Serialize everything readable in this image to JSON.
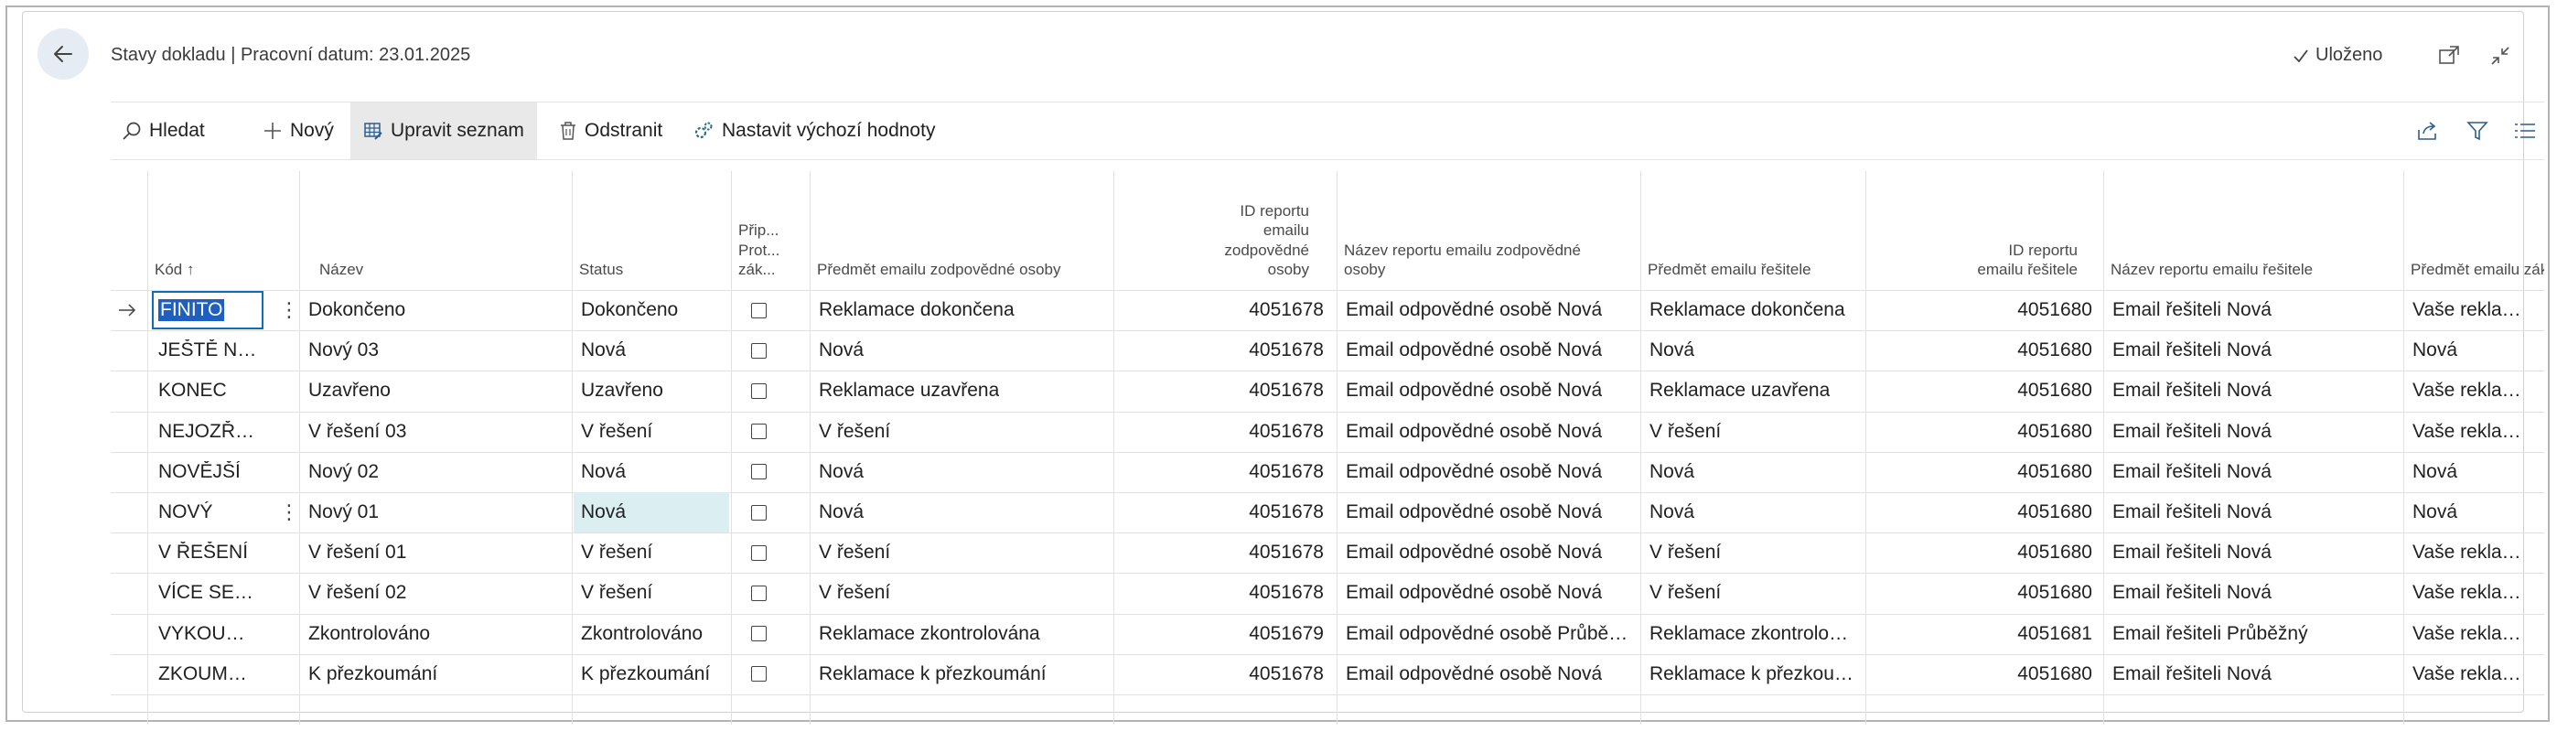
{
  "header": {
    "title": "Stavy dokladu | Pracovní datum: 23.01.2025",
    "saved_label": "Uloženo"
  },
  "actions": {
    "search": "Hledat",
    "new": "Nový",
    "edit_list": "Upravit seznam",
    "delete": "Odstranit",
    "set_defaults": "Nastavit výchozí hodnoty"
  },
  "columns": {
    "code": "Kód ↑",
    "name": "Název",
    "status": "Status",
    "attach_l1": "Přip...",
    "attach_l2": "Prot...",
    "attach_l3": "zák...",
    "resp_subject": "Předmět emailu zodpovědné osoby",
    "resp_report_id_l1": "ID reportu",
    "resp_report_id_l2": "emailu",
    "resp_report_id_l3": "zodpovědné",
    "resp_report_id_l4": "osoby",
    "resp_report_name_l1": "Název reportu emailu zodpovědné",
    "resp_report_name_l2": "osoby",
    "solver_subject": "Předmět emailu řešitele",
    "solver_report_id_l1": "ID reportu",
    "solver_report_id_l2": "emailu řešitele",
    "solver_report_name": "Název reportu emailu řešitele",
    "customer_subject": "Předmět emailu zákazníka"
  },
  "rows": [
    {
      "code": "FINITO",
      "name": "Dokončeno",
      "status": "Dokončeno",
      "resp_subject": "Reklamace dokončena",
      "resp_id": "4051678",
      "resp_report": "Email odpovědné osobě Nová",
      "solver_subject": "Reklamace dokončena",
      "solver_id": "4051680",
      "solver_report": "Email řešiteli Nová",
      "customer_subject": "Vaše reklamace byla dokončena"
    },
    {
      "code": "JEŠTĚ NOVĚJŠÍ",
      "name": "Nový 03",
      "status": "Nová",
      "resp_subject": "Nová",
      "resp_id": "4051678",
      "resp_report": "Email odpovědné osobě Nová",
      "solver_subject": "Nová",
      "solver_id": "4051680",
      "solver_report": "Email řešiteli Nová",
      "customer_subject": "Nová"
    },
    {
      "code": "KONEC",
      "name": "Uzavřeno",
      "status": "Uzavřeno",
      "resp_subject": "Reklamace uzavřena",
      "resp_id": "4051678",
      "resp_report": "Email odpovědné osobě Nová",
      "solver_subject": "Reklamace uzavřena",
      "solver_id": "4051680",
      "solver_report": "Email řešiteli Nová",
      "customer_subject": "Vaše reklamace byla uzavřena"
    },
    {
      "code": "NEJOZŘEŠENĚJŠÍ",
      "name": "V řešení 03",
      "status": "V řešení",
      "resp_subject": "V řešení",
      "resp_id": "4051678",
      "resp_report": "Email odpovědné osobě Nová",
      "solver_subject": "V řešení",
      "solver_id": "4051680",
      "solver_report": "Email řešiteli Nová",
      "customer_subject": "Vaše reklamace je nyní v řešení"
    },
    {
      "code": "NOVĚJŠÍ",
      "name": "Nový 02",
      "status": "Nová",
      "resp_subject": "Nová",
      "resp_id": "4051678",
      "resp_report": "Email odpovědné osobě Nová",
      "solver_subject": "Nová",
      "solver_id": "4051680",
      "solver_report": "Email řešiteli Nová",
      "customer_subject": "Nová"
    },
    {
      "code": "NOVÝ",
      "name": "Nový 01",
      "status": "Nová",
      "resp_subject": "Nová",
      "resp_id": "4051678",
      "resp_report": "Email odpovědné osobě Nová",
      "solver_subject": "Nová",
      "solver_id": "4051680",
      "solver_report": "Email řešiteli Nová",
      "customer_subject": "Nová"
    },
    {
      "code": "V ŘEŠENÍ",
      "name": "V řešení 01",
      "status": "V řešení",
      "resp_subject": "V řešení",
      "resp_id": "4051678",
      "resp_report": "Email odpovědné osobě Nová",
      "solver_subject": "V řešení",
      "solver_id": "4051680",
      "solver_report": "Email řešiteli Nová",
      "customer_subject": "Vaše reklamace je nyní v řešení"
    },
    {
      "code": "VÍCE SE ŘEŠÍ",
      "name": "V řešení 02",
      "status": "V řešení",
      "resp_subject": "V řešení",
      "resp_id": "4051678",
      "resp_report": "Email odpovědné osobě Nová",
      "solver_subject": "V řešení",
      "solver_id": "4051680",
      "solver_report": "Email řešiteli Nová",
      "customer_subject": "Vaše reklamace je nyní v řešení"
    },
    {
      "code": "VYKOUMÁNO",
      "name": "Zkontrolováno",
      "status": "Zkontrolováno",
      "resp_subject": "Reklamace zkontrolována",
      "resp_id": "4051679",
      "resp_report": "Email odpovědné osobě Průběžný",
      "solver_subject": "Reklamace zkontrolována",
      "solver_id": "4051681",
      "solver_report": "Email řešiteli Průběžný",
      "customer_subject": "Vaše reklamace byla zkontrolována"
    },
    {
      "code": "ZKOUMÁNÍ",
      "name": "K přezkoumání",
      "status": "K přezkoumání",
      "resp_subject": "Reklamace k přezkoumání",
      "resp_id": "4051678",
      "resp_report": "Email odpovědné osobě Nová",
      "solver_subject": "Reklamace k přezkoumání",
      "solver_id": "4051680",
      "solver_report": "Email řešiteli Nová",
      "customer_subject": "Vaše reklamace čeká na přezkoumání"
    }
  ],
  "colors": {
    "accent": "#0f6cbd",
    "selection_fill": "#1f5fbf",
    "status_highlight": "#dbeff3",
    "back_button_bg": "#e6ecf3"
  }
}
